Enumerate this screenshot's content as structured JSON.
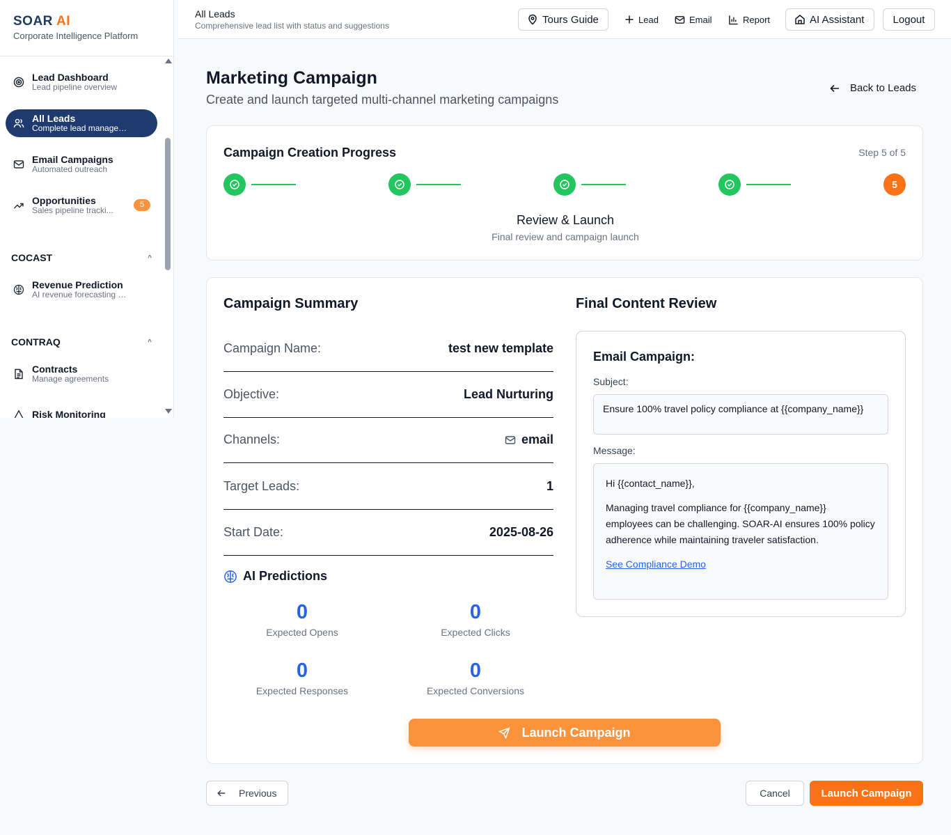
{
  "brand": {
    "logo_main": "SOAR",
    "logo_accent": "AI",
    "subtitle": "Corporate Intelligence Platform"
  },
  "sidebar": {
    "items": [
      {
        "title": "Lead Dashboard",
        "subtitle": "Lead pipeline overview"
      },
      {
        "title": "All Leads",
        "subtitle": "Complete lead managem..."
      },
      {
        "title": "Email Campaigns",
        "subtitle": "Automated outreach"
      },
      {
        "title": "Opportunities",
        "subtitle": "Sales pipeline tracki...",
        "badge": "5"
      },
      {
        "title": "Revenue Prediction",
        "subtitle": "AI revenue forecasting & s..."
      },
      {
        "title": "Contracts",
        "subtitle": "Manage agreements"
      },
      {
        "title": "Risk Monitoring",
        "subtitle": ""
      }
    ],
    "sections": [
      "COCAST",
      "CONTRAQ"
    ]
  },
  "topbar": {
    "title": "All Leads",
    "subtitle": "Comprehensive lead list with status and suggestions",
    "tours_guide": "Tours Guide",
    "lead": "Lead",
    "email": "Email",
    "report": "Report",
    "ai_assistant": "AI Assistant",
    "logout": "Logout"
  },
  "page": {
    "title": "Marketing Campaign",
    "subtitle": "Create and launch targeted multi-channel marketing campaigns",
    "back": "Back to Leads"
  },
  "progress": {
    "title": "Campaign Creation Progress",
    "step_text": "Step 5 of 5",
    "current_step_number": "5",
    "current_step_name": "Review & Launch",
    "current_step_desc": "Final review and campaign launch"
  },
  "summary": {
    "title": "Campaign Summary",
    "rows": [
      {
        "key": "Campaign Name:",
        "value": "test new template"
      },
      {
        "key": "Objective:",
        "value": "Lead Nurturing"
      },
      {
        "key": "Channels:",
        "value": "email"
      },
      {
        "key": "Target Leads:",
        "value": "1"
      },
      {
        "key": "Start Date:",
        "value": "2025-08-26"
      }
    ]
  },
  "ai_predictions": {
    "title": "AI Predictions",
    "metrics": [
      {
        "value": "0",
        "label": "Expected Opens"
      },
      {
        "value": "0",
        "label": "Expected Clicks"
      },
      {
        "value": "0",
        "label": "Expected Responses"
      },
      {
        "value": "0",
        "label": "Expected Conversions"
      }
    ]
  },
  "review": {
    "title": "Final Content Review",
    "box_title": "Email Campaign:",
    "subject_label": "Subject:",
    "subject": "Ensure 100% travel policy compliance at {{company_name}}",
    "message_label": "Message:",
    "greeting": "Hi {{contact_name}},",
    "body": "Managing travel compliance for {{company_name}} employees can be challenging. SOAR-AI ensures 100% policy adherence while maintaining traveler satisfaction.",
    "link": "See Compliance Demo"
  },
  "actions": {
    "launch_main": "Launch Campaign",
    "previous": "Previous",
    "cancel": "Cancel",
    "launch": "Launch Campaign"
  },
  "colors": {
    "accent": "#f97316",
    "success": "#22c55e",
    "primary": "#1e3a6f",
    "metric": "#2563eb"
  }
}
